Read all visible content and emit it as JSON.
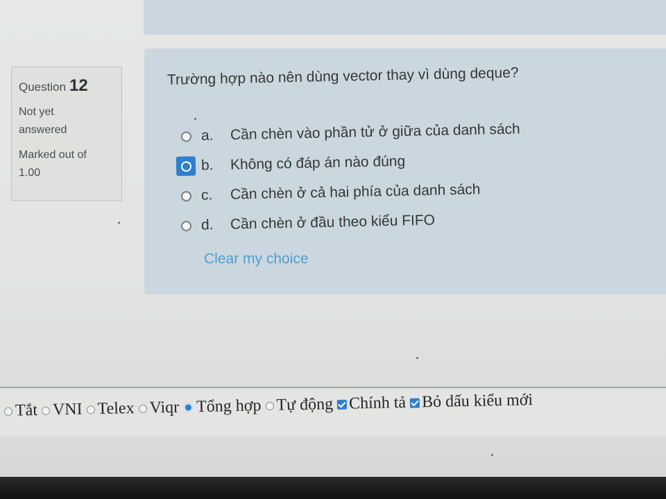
{
  "info": {
    "question_label": "Question",
    "question_number": "12",
    "state": "Not yet answered",
    "marks": "Marked out of 1.00"
  },
  "question": {
    "text": "Trường hợp nào nên dùng vector thay vì dùng deque?",
    "answers": [
      {
        "letter": "a.",
        "text": "Cần chèn vào phần tử ở giữa của danh sách",
        "checked": false
      },
      {
        "letter": "b.",
        "text": "Không có đáp án nào đúng",
        "checked": true
      },
      {
        "letter": "c.",
        "text": "Cần chèn ở cả hai phía của danh sách",
        "checked": false
      },
      {
        "letter": "d.",
        "text": "Cần chèn ở đầu theo kiểu FIFO",
        "checked": false
      }
    ],
    "clear_label": "Clear my choice"
  },
  "ime_bar": {
    "options": [
      {
        "label": "Tắt",
        "checked": false
      },
      {
        "label": "VNI",
        "checked": false
      },
      {
        "label": "Telex",
        "checked": false
      },
      {
        "label": "Viqr",
        "checked": false
      },
      {
        "label": "Tổng hợp",
        "checked": true
      },
      {
        "label": "Tự động",
        "checked": false
      }
    ],
    "checkboxes": [
      {
        "label": "Chính tả",
        "checked": true
      },
      {
        "label": "Bỏ dấu kiểu mới",
        "checked": true
      }
    ]
  },
  "colors": {
    "accent": "#2f7fce",
    "link": "#4f9fd0",
    "panel": "#cbd7df"
  }
}
